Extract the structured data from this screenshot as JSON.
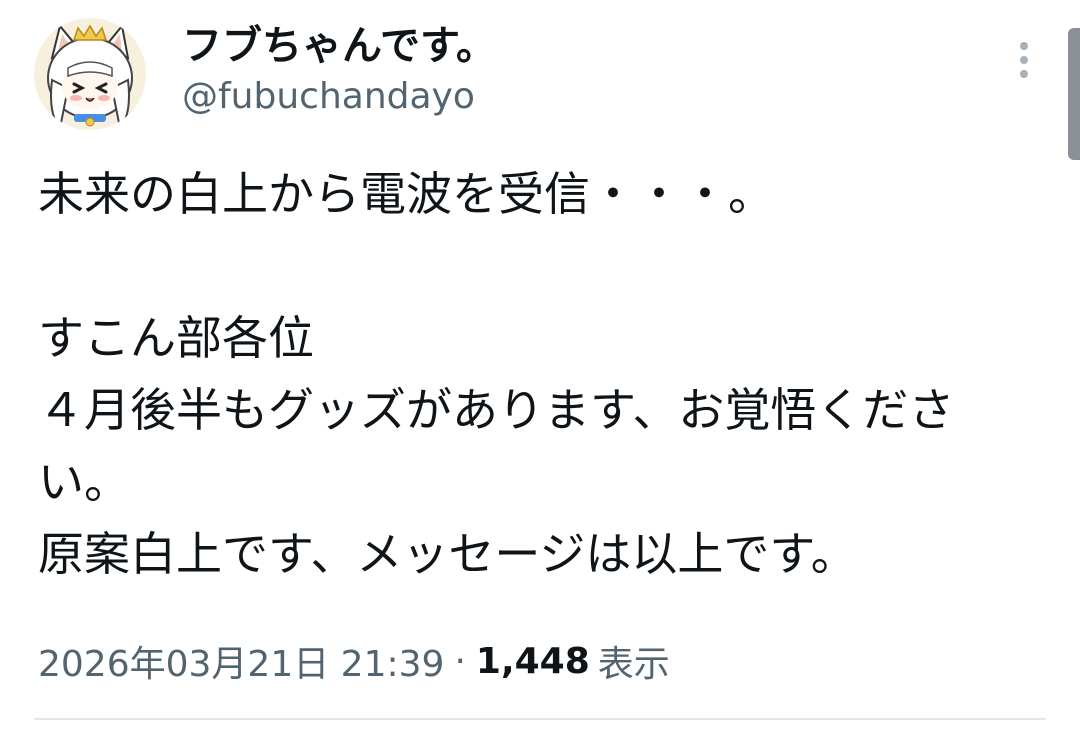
{
  "author": {
    "display_name": "フブちゃんです。",
    "handle": "@fubuchandayo",
    "avatar_icon": "fox-girl-avatar"
  },
  "tweet": {
    "text": "未来の白上から電波を受信・・・。\n\nすこん部各位\n４月後半もグッズがあります、お覚悟ください。\n原案白上です、メッセージは以上です。",
    "timestamp": "2026年03月21日 21:39",
    "separator": "·",
    "views_count": "1,448",
    "views_label": "表示"
  },
  "colors": {
    "primary_text": "#0f1419",
    "secondary_text": "#536471",
    "divider": "#e3e7ea"
  }
}
